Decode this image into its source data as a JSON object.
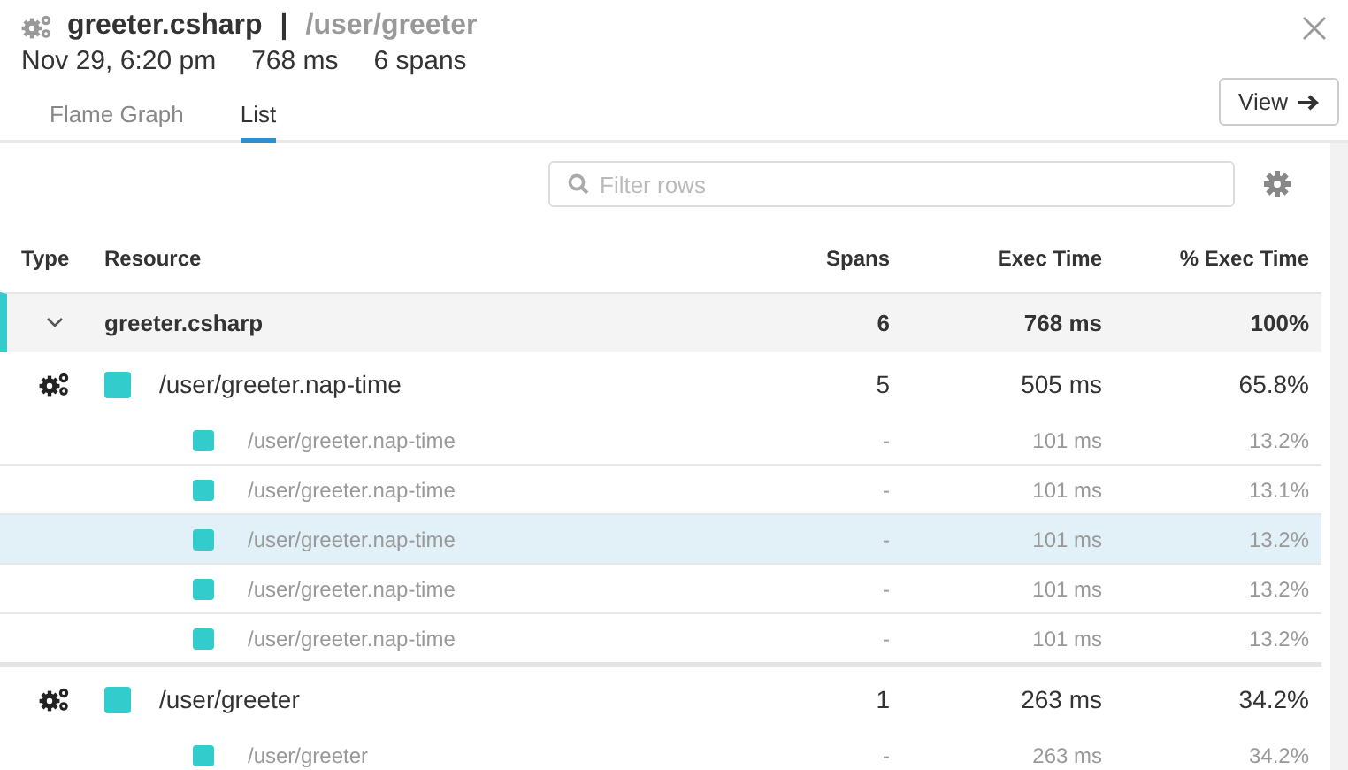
{
  "header": {
    "service": "greeter.csharp",
    "separator": "|",
    "resource": "/user/greeter",
    "date": "Nov 29, 6:20 pm",
    "duration": "768 ms",
    "spans": "6 spans"
  },
  "tabs": [
    {
      "label": "Flame Graph",
      "selected": false
    },
    {
      "label": "List",
      "selected": true
    }
  ],
  "view_button": {
    "label": "View"
  },
  "filter": {
    "placeholder": "Filter rows"
  },
  "table": {
    "columns": [
      "Type",
      "Resource",
      "Spans",
      "Exec Time",
      "% Exec Time"
    ],
    "groups": [
      {
        "name": "greeter.csharp",
        "expanded": true,
        "spans": "6",
        "exec_time": "768 ms",
        "pct": "100%",
        "children": [
          {
            "resource": "/user/greeter.nap-time",
            "spans": "5",
            "exec_time": "505 ms",
            "pct": "65.8%",
            "children": [
              {
                "resource": "/user/greeter.nap-time",
                "spans": "-",
                "exec_time": "101 ms",
                "pct": "13.2%",
                "selected": false
              },
              {
                "resource": "/user/greeter.nap-time",
                "spans": "-",
                "exec_time": "101 ms",
                "pct": "13.1%",
                "selected": false
              },
              {
                "resource": "/user/greeter.nap-time",
                "spans": "-",
                "exec_time": "101 ms",
                "pct": "13.2%",
                "selected": true
              },
              {
                "resource": "/user/greeter.nap-time",
                "spans": "-",
                "exec_time": "101 ms",
                "pct": "13.2%",
                "selected": false
              },
              {
                "resource": "/user/greeter.nap-time",
                "spans": "-",
                "exec_time": "101 ms",
                "pct": "13.2%",
                "selected": false
              }
            ]
          },
          {
            "resource": "/user/greeter",
            "spans": "1",
            "exec_time": "263 ms",
            "pct": "34.2%",
            "children": [
              {
                "resource": "/user/greeter",
                "spans": "-",
                "exec_time": "263 ms",
                "pct": "34.2%",
                "selected": false
              }
            ]
          }
        ]
      }
    ]
  }
}
